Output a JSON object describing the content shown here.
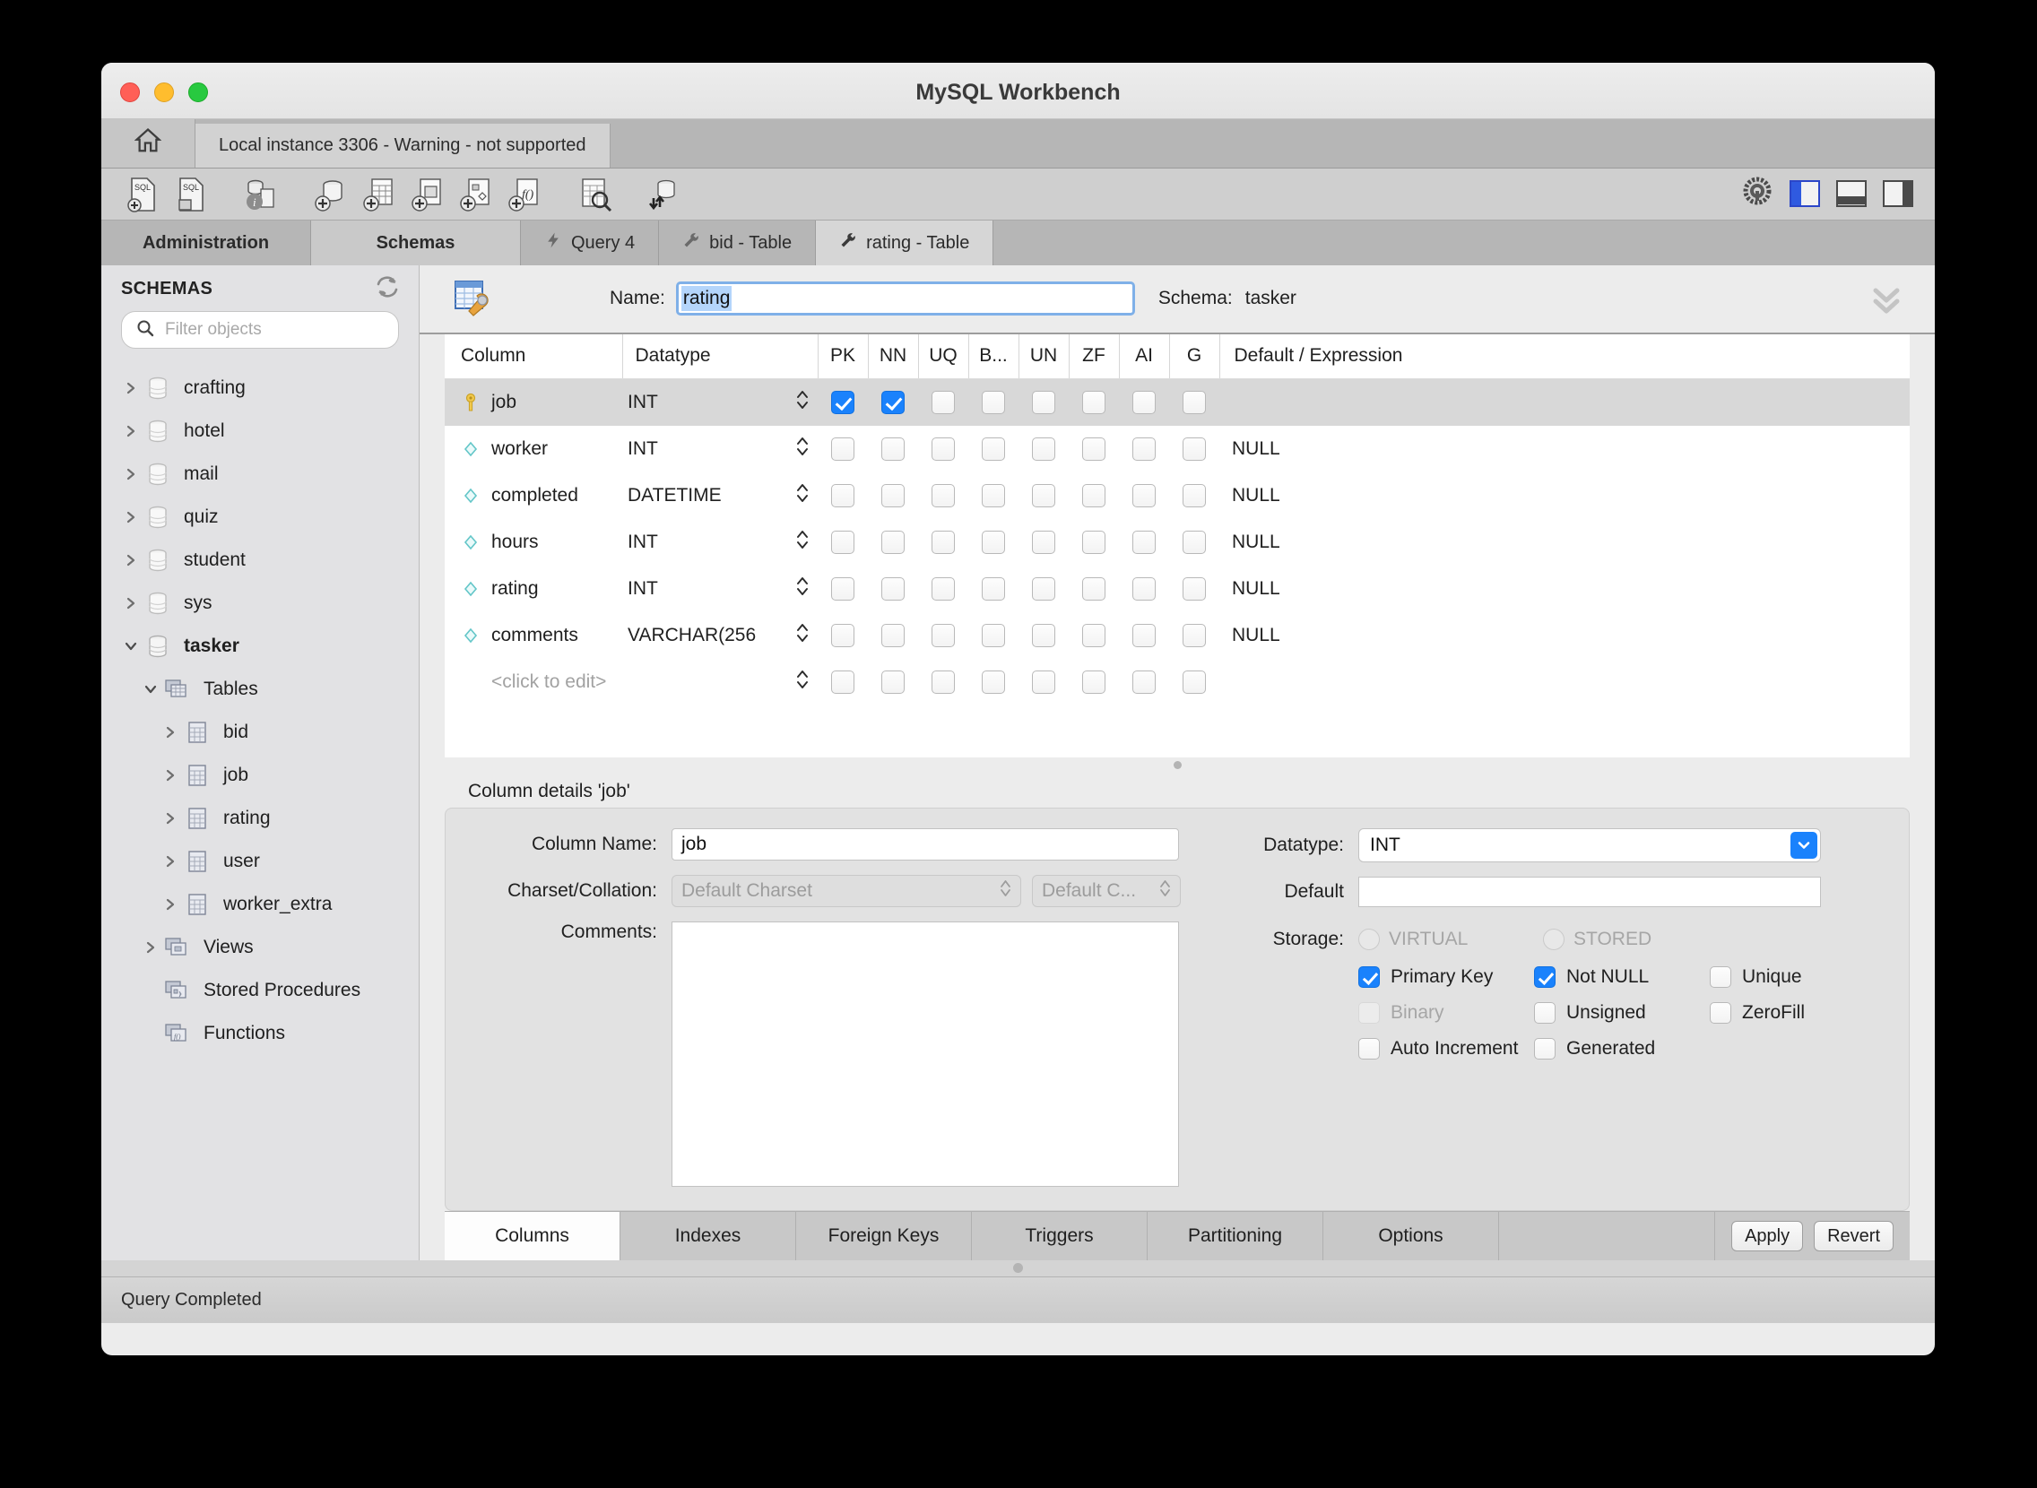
{
  "window": {
    "title": "MySQL Workbench",
    "traffic": {
      "close": "close-button",
      "minimize": "minimize-button",
      "maximize": "maximize-button"
    }
  },
  "connection_strip": {
    "home_icon": "home-icon",
    "connection_tab": "Local instance 3306 - Warning - not supported"
  },
  "toolbar": {
    "icons": [
      "new-sql-tab-icon",
      "open-sql-script-icon",
      "connection-info-icon",
      "create-schema-icon",
      "create-table-icon",
      "create-view-icon",
      "create-procedure-icon",
      "create-function-icon",
      "inspect-table-icon",
      "reconnect-server-icon"
    ],
    "right_icons": [
      "gear-icon",
      "toggle-sidebar-button",
      "toggle-output-button",
      "toggle-secondary-sidebar-button"
    ]
  },
  "side_tabs": [
    {
      "label": "Administration",
      "active": false
    },
    {
      "label": "Schemas",
      "active": true
    }
  ],
  "editor_tabs": [
    {
      "label": "Query 4",
      "icon": "lightning-icon",
      "active": false
    },
    {
      "label": "bid - Table",
      "icon": "wrench-icon",
      "active": false
    },
    {
      "label": "rating - Table",
      "icon": "wrench-icon",
      "active": true
    }
  ],
  "sidebar": {
    "section_label": "SCHEMAS",
    "refresh_icon": "refresh-icon",
    "filter": {
      "placeholder": "Filter objects",
      "value": "",
      "icon": "search-icon"
    },
    "tree": [
      {
        "label": "crafting",
        "level": 0,
        "icon": "schema-icon",
        "expanded": false,
        "bold": false
      },
      {
        "label": "hotel",
        "level": 0,
        "icon": "schema-icon",
        "expanded": false,
        "bold": false
      },
      {
        "label": "mail",
        "level": 0,
        "icon": "schema-icon",
        "expanded": false,
        "bold": false
      },
      {
        "label": "quiz",
        "level": 0,
        "icon": "schema-icon",
        "expanded": false,
        "bold": false
      },
      {
        "label": "student",
        "level": 0,
        "icon": "schema-icon",
        "expanded": false,
        "bold": false
      },
      {
        "label": "sys",
        "level": 0,
        "icon": "schema-icon",
        "expanded": false,
        "bold": false
      },
      {
        "label": "tasker",
        "level": 0,
        "icon": "schema-icon",
        "expanded": true,
        "bold": true
      },
      {
        "label": "Tables",
        "level": 1,
        "icon": "tables-folder-icon",
        "expanded": true,
        "bold": false
      },
      {
        "label": "bid",
        "level": 2,
        "icon": "table-icon",
        "expanded": false,
        "bold": false
      },
      {
        "label": "job",
        "level": 2,
        "icon": "table-icon",
        "expanded": false,
        "bold": false
      },
      {
        "label": "rating",
        "level": 2,
        "icon": "table-icon",
        "expanded": false,
        "bold": false
      },
      {
        "label": "user",
        "level": 2,
        "icon": "table-icon",
        "expanded": false,
        "bold": false
      },
      {
        "label": "worker_extra",
        "level": 2,
        "icon": "table-icon",
        "expanded": false,
        "bold": false
      },
      {
        "label": "Views",
        "level": 1,
        "icon": "views-folder-icon",
        "expanded": false,
        "bold": false
      },
      {
        "label": "Stored Procedures",
        "level": 1,
        "icon": "procedures-folder-icon",
        "expanded": null,
        "bold": false
      },
      {
        "label": "Functions",
        "level": 1,
        "icon": "functions-folder-icon",
        "expanded": null,
        "bold": false
      }
    ]
  },
  "table_editor": {
    "table_icon": "table-editor-icon",
    "name_label": "Name:",
    "name_value": "rating",
    "schema_label": "Schema:",
    "schema_value": "tasker",
    "collapse_icon": "double-chevron-down-icon",
    "grid": {
      "headers": [
        "Column",
        "Datatype",
        "PK",
        "NN",
        "UQ",
        "B...",
        "UN",
        "ZF",
        "AI",
        "G",
        "Default / Expression"
      ],
      "rows": [
        {
          "name": "job",
          "icon": "primary-key-icon",
          "datatype": "INT",
          "pk": true,
          "nn": true,
          "uq": false,
          "b": false,
          "un": false,
          "zf": false,
          "ai": false,
          "g": false,
          "default": "",
          "selected": true,
          "placeholder": false
        },
        {
          "name": "worker",
          "icon": "column-icon",
          "datatype": "INT",
          "pk": false,
          "nn": false,
          "uq": false,
          "b": false,
          "un": false,
          "zf": false,
          "ai": false,
          "g": false,
          "default": "NULL",
          "selected": false,
          "placeholder": false
        },
        {
          "name": "completed",
          "icon": "column-icon",
          "datatype": "DATETIME",
          "pk": false,
          "nn": false,
          "uq": false,
          "b": false,
          "un": false,
          "zf": false,
          "ai": false,
          "g": false,
          "default": "NULL",
          "selected": false,
          "placeholder": false
        },
        {
          "name": "hours",
          "icon": "column-icon",
          "datatype": "INT",
          "pk": false,
          "nn": false,
          "uq": false,
          "b": false,
          "un": false,
          "zf": false,
          "ai": false,
          "g": false,
          "default": "NULL",
          "selected": false,
          "placeholder": false
        },
        {
          "name": "rating",
          "icon": "column-icon",
          "datatype": "INT",
          "pk": false,
          "nn": false,
          "uq": false,
          "b": false,
          "un": false,
          "zf": false,
          "ai": false,
          "g": false,
          "default": "NULL",
          "selected": false,
          "placeholder": false
        },
        {
          "name": "comments",
          "icon": "column-icon",
          "datatype": "VARCHAR(256",
          "pk": false,
          "nn": false,
          "uq": false,
          "b": false,
          "un": false,
          "zf": false,
          "ai": false,
          "g": false,
          "default": "NULL",
          "selected": false,
          "placeholder": false
        },
        {
          "name": "<click to edit>",
          "icon": "none",
          "datatype": "",
          "pk": false,
          "nn": false,
          "uq": false,
          "b": false,
          "un": false,
          "zf": false,
          "ai": false,
          "g": false,
          "default": "",
          "selected": false,
          "placeholder": true
        }
      ]
    }
  },
  "column_details": {
    "title": "Column details 'job'",
    "column_name_label": "Column Name:",
    "column_name_value": "job",
    "charset_label": "Charset/Collation:",
    "charset_value": "Default Charset",
    "collation_value": "Default C...",
    "comments_label": "Comments:",
    "comments_value": "",
    "datatype_label": "Datatype:",
    "datatype_value": "INT",
    "default_label": "Default",
    "default_value": "",
    "storage_label": "Storage:",
    "storage_options": [
      {
        "label": "VIRTUAL",
        "selected": false,
        "disabled": true
      },
      {
        "label": "STORED",
        "selected": false,
        "disabled": true
      }
    ],
    "flags": [
      {
        "label": "Primary Key",
        "checked": true,
        "disabled": false
      },
      {
        "label": "Not NULL",
        "checked": true,
        "disabled": false
      },
      {
        "label": "Unique",
        "checked": false,
        "disabled": false
      },
      {
        "label": "Binary",
        "checked": false,
        "disabled": true
      },
      {
        "label": "Unsigned",
        "checked": false,
        "disabled": false
      },
      {
        "label": "ZeroFill",
        "checked": false,
        "disabled": false
      },
      {
        "label": "Auto Increment",
        "checked": false,
        "disabled": false
      },
      {
        "label": "Generated",
        "checked": false,
        "disabled": false
      }
    ]
  },
  "bottom_tabs": [
    {
      "label": "Columns",
      "active": true
    },
    {
      "label": "Indexes",
      "active": false
    },
    {
      "label": "Foreign Keys",
      "active": false
    },
    {
      "label": "Triggers",
      "active": false
    },
    {
      "label": "Partitioning",
      "active": false
    },
    {
      "label": "Options",
      "active": false
    }
  ],
  "action_buttons": [
    {
      "label": "Apply"
    },
    {
      "label": "Revert"
    }
  ],
  "status_bar": {
    "text": "Query Completed"
  },
  "colors": {
    "accent_blue": "#1a82fc",
    "selection_blue": "#b4d5fb",
    "focus_ring": "#7fb0e8",
    "window_bg": "#ececec",
    "sidebar_bg": "#e2e2e4",
    "toolbar_bg": "#cfcfcf"
  }
}
